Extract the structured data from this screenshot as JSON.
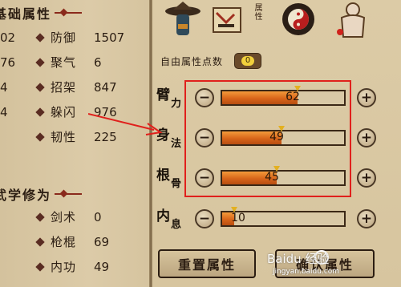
{
  "left_panel": {
    "basic_header": "基础属性",
    "basic_stats": [
      {
        "cut_value": "02",
        "name": "防御",
        "value": "1507"
      },
      {
        "cut_value": "76",
        "name": "聚气",
        "value": "6"
      },
      {
        "cut_value": "4",
        "name": "招架",
        "value": "847"
      },
      {
        "cut_value": "4",
        "name": "躲闪",
        "value": "976"
      },
      {
        "cut_value": "",
        "name": "韧性",
        "value": "225"
      }
    ],
    "martial_header": "武学修为",
    "martial_stats": [
      {
        "name": "剑术",
        "value": "0"
      },
      {
        "name": "枪棍",
        "value": "69"
      },
      {
        "name": "内功",
        "value": "49"
      }
    ]
  },
  "tabs": {
    "active_label": "属性",
    "icons": [
      "straw-hat-warrior-icon",
      "scroll-map-icon",
      "yin-yang-bagua-icon",
      "muscle-man-icon"
    ]
  },
  "attributes": {
    "free_points_label": "自由属性点数",
    "free_points_value": "0",
    "rows": [
      {
        "name": "臂力",
        "value": "62",
        "fill": 0.62,
        "chars": [
          "臂",
          "力"
        ]
      },
      {
        "name": "身法",
        "value": "49",
        "fill": 0.49,
        "chars": [
          "身",
          "法"
        ]
      },
      {
        "name": "根骨",
        "value": "45",
        "fill": 0.45,
        "chars": [
          "根",
          "骨"
        ]
      },
      {
        "name": "内息",
        "value": "10",
        "fill": 0.1,
        "chars": [
          "内",
          "息"
        ]
      }
    ],
    "max_value": 100
  },
  "buttons": {
    "reset": "重置属性",
    "confirm": "确认属性"
  },
  "watermark": {
    "text": "Baidu 经验",
    "url": "jingyan.baidu.com"
  },
  "colors": {
    "bar_fill": "#d8651a",
    "highlight": "#e0201c"
  }
}
